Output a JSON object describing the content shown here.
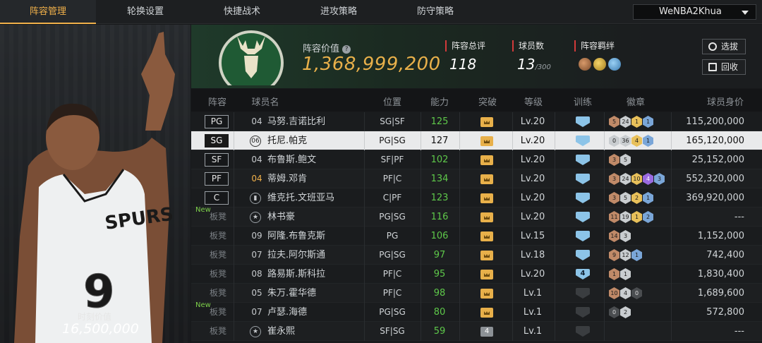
{
  "nav": {
    "tabs": [
      "阵容管理",
      "轮换设置",
      "快捷战术",
      "进攻策略",
      "防守策略"
    ],
    "active_tab": 0,
    "account": "WeNBA2Khua"
  },
  "featured_player": {
    "value_label": "时刻价值",
    "value": "16,500,000",
    "jersey_number": "9",
    "jersey_text": "SPURS"
  },
  "team": {
    "lineup_value_label": "阵容价值",
    "lineup_value": "1,368,999,200",
    "overall_label": "阵容总评",
    "overall": "118",
    "player_count_label": "球员数",
    "player_count": "13",
    "player_count_max": "/300",
    "bond_label": "阵容羁绊",
    "bond_icons": [
      "bond-icon-brown",
      "bond-icon-gold",
      "bond-icon-blue"
    ],
    "buttons": {
      "select": "选拔",
      "recycle": "回收"
    },
    "accent_green": "#1f3a2a"
  },
  "table": {
    "headers": {
      "lineup": "阵容",
      "name": "球员名",
      "position": "位置",
      "ability": "能力",
      "breakthrough": "突破",
      "level": "等级",
      "training": "训练",
      "badges": "徽章",
      "salary": "球员身价"
    },
    "rows": [
      {
        "slot": "PG",
        "new": "",
        "num": "04",
        "num_style": "plain",
        "name": "马努.吉诺比利",
        "pos": "SG|SF",
        "ability": "125",
        "ability_green": true,
        "break": "crown",
        "level": "Lv.20",
        "train": "full",
        "badges": [
          [
            "br",
            "5"
          ],
          [
            "si",
            "24"
          ],
          [
            "go",
            "1"
          ],
          [
            "hof",
            "1"
          ]
        ],
        "salary": "115,200,000"
      },
      {
        "slot": "SG",
        "new": "",
        "num": "06",
        "num_style": "circle",
        "name": "托尼.帕克",
        "pos": "PG|SG",
        "ability": "127",
        "ability_green": false,
        "break": "crown",
        "level": "Lv.20",
        "train": "full",
        "badges": [
          [
            "si",
            "0"
          ],
          [
            "si",
            "36"
          ],
          [
            "go",
            "4"
          ],
          [
            "hof",
            "1"
          ]
        ],
        "salary": "165,120,000",
        "selected": true
      },
      {
        "slot": "SF",
        "new": "",
        "num": "04",
        "num_style": "plain",
        "name": "布鲁斯.鲍文",
        "pos": "SF|PF",
        "ability": "102",
        "ability_green": true,
        "break": "crown",
        "level": "Lv.20",
        "train": "full",
        "badges": [
          [
            "br",
            "3"
          ],
          [
            "si",
            "5"
          ]
        ],
        "salary": "25,152,000"
      },
      {
        "slot": "PF",
        "new": "",
        "num": "04",
        "num_style": "gold",
        "name": "蒂姆.邓肯",
        "pos": "PF|C",
        "ability": "134",
        "ability_green": true,
        "break": "crown",
        "level": "Lv.20",
        "train": "full",
        "badges": [
          [
            "br",
            "3"
          ],
          [
            "si",
            "24"
          ],
          [
            "go",
            "10"
          ],
          [
            "pu",
            "4"
          ],
          [
            "hof",
            "3"
          ]
        ],
        "salary": "552,320,000"
      },
      {
        "slot": "C",
        "new": "",
        "num": "",
        "num_style": "bars",
        "name": "维克托.文班亚马",
        "pos": "C|PF",
        "ability": "123",
        "ability_green": true,
        "break": "crown",
        "level": "Lv.20",
        "train": "full",
        "badges": [
          [
            "br",
            "3"
          ],
          [
            "si",
            "5"
          ],
          [
            "go",
            "2"
          ],
          [
            "hof",
            "1"
          ]
        ],
        "salary": "369,920,000"
      },
      {
        "slot": "板凳",
        "new": "New",
        "num": "",
        "num_style": "star",
        "name": "林书豪",
        "pos": "PG|SG",
        "ability": "116",
        "ability_green": true,
        "break": "crown",
        "level": "Lv.20",
        "train": "full",
        "badges": [
          [
            "br",
            "11"
          ],
          [
            "si",
            "19"
          ],
          [
            "go",
            "1"
          ],
          [
            "hof",
            "2"
          ]
        ],
        "salary": "---"
      },
      {
        "slot": "板凳",
        "new": "",
        "num": "09",
        "num_style": "plain",
        "name": "阿隆.布鲁克斯",
        "pos": "PG",
        "ability": "106",
        "ability_green": true,
        "break": "crown",
        "level": "Lv.15",
        "train": "full",
        "badges": [
          [
            "br",
            "14"
          ],
          [
            "si",
            "3"
          ]
        ],
        "salary": "1,152,000"
      },
      {
        "slot": "板凳",
        "new": "",
        "num": "07",
        "num_style": "plain",
        "name": "拉夫.阿尔斯通",
        "pos": "PG|SG",
        "ability": "97",
        "ability_green": true,
        "break": "crown",
        "level": "Lv.18",
        "train": "full",
        "badges": [
          [
            "br",
            "9"
          ],
          [
            "si",
            "12"
          ],
          [
            "hof",
            "1"
          ]
        ],
        "salary": "742,400"
      },
      {
        "slot": "板凳",
        "new": "",
        "num": "08",
        "num_style": "plain",
        "name": "路易斯.斯科拉",
        "pos": "PF|C",
        "ability": "95",
        "ability_green": true,
        "break": "crown",
        "level": "Lv.20",
        "train": "num",
        "train_num": "4",
        "badges": [
          [
            "br",
            "1"
          ],
          [
            "si",
            "1"
          ]
        ],
        "salary": "1,830,400"
      },
      {
        "slot": "板凳",
        "new": "",
        "num": "05",
        "num_style": "plain",
        "name": "朱万.霍华德",
        "pos": "PF|C",
        "ability": "98",
        "ability_green": true,
        "break": "crown",
        "level": "Lv.1",
        "train": "dim",
        "badges": [
          [
            "br",
            "10"
          ],
          [
            "si",
            "4"
          ],
          [
            "dk",
            "0"
          ]
        ],
        "salary": "1,689,600"
      },
      {
        "slot": "板凳",
        "new": "New",
        "num": "07",
        "num_style": "plain",
        "name": "卢瑟.海德",
        "pos": "PG|SG",
        "ability": "80",
        "ability_green": true,
        "break": "crown",
        "level": "Lv.1",
        "train": "dim",
        "badges": [
          [
            "dk",
            "0"
          ],
          [
            "si",
            "2"
          ]
        ],
        "salary": "572,800"
      },
      {
        "slot": "板凳",
        "new": "",
        "num": "",
        "num_style": "star",
        "name": "崔永熙",
        "pos": "SF|SG",
        "ability": "59",
        "ability_green": true,
        "break": "gray",
        "break_num": "4",
        "level": "Lv.1",
        "train": "dim",
        "badges": [],
        "salary": "---"
      }
    ]
  }
}
